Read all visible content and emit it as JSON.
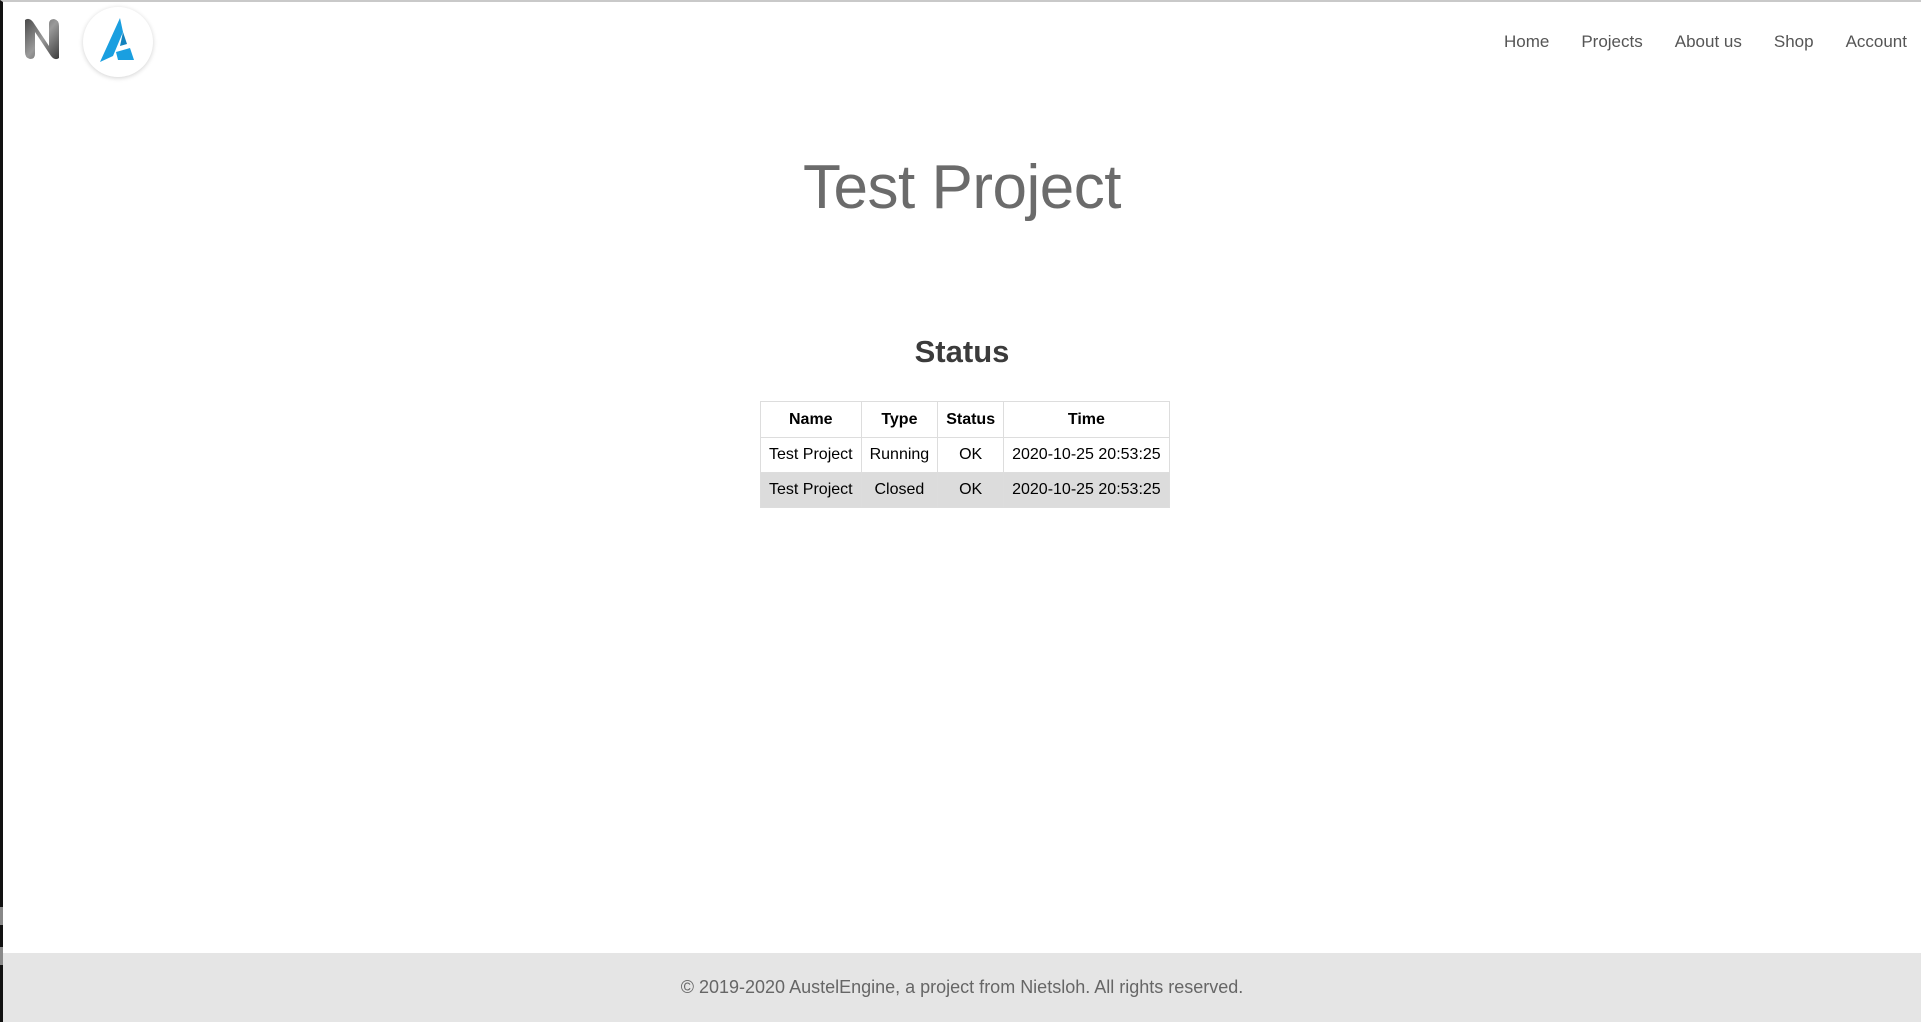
{
  "header": {
    "logo_left": "N-logo",
    "logo_right": "A-logo",
    "nav": [
      {
        "label": "Home"
      },
      {
        "label": "Projects"
      },
      {
        "label": "About us"
      },
      {
        "label": "Shop"
      },
      {
        "label": "Account"
      }
    ]
  },
  "main": {
    "page_title": "Test Project",
    "section_title": "Status",
    "table": {
      "headers": [
        "Name",
        "Type",
        "Status",
        "Time"
      ],
      "rows": [
        {
          "name": "Test Project",
          "type": "Running",
          "status": "OK",
          "time": "2020-10-25 20:53:25"
        },
        {
          "name": "Test Project",
          "type": "Closed",
          "status": "OK",
          "time": "2020-10-25 20:53:25"
        }
      ]
    }
  },
  "footer": {
    "text": "© 2019-2020 AustelEngine, a project from Nietsloh. All rights reserved."
  },
  "colors": {
    "accent_blue": "#1a9fe0",
    "footer_bg": "#e5e5e5",
    "shaded_row": "#dcdcdc"
  }
}
